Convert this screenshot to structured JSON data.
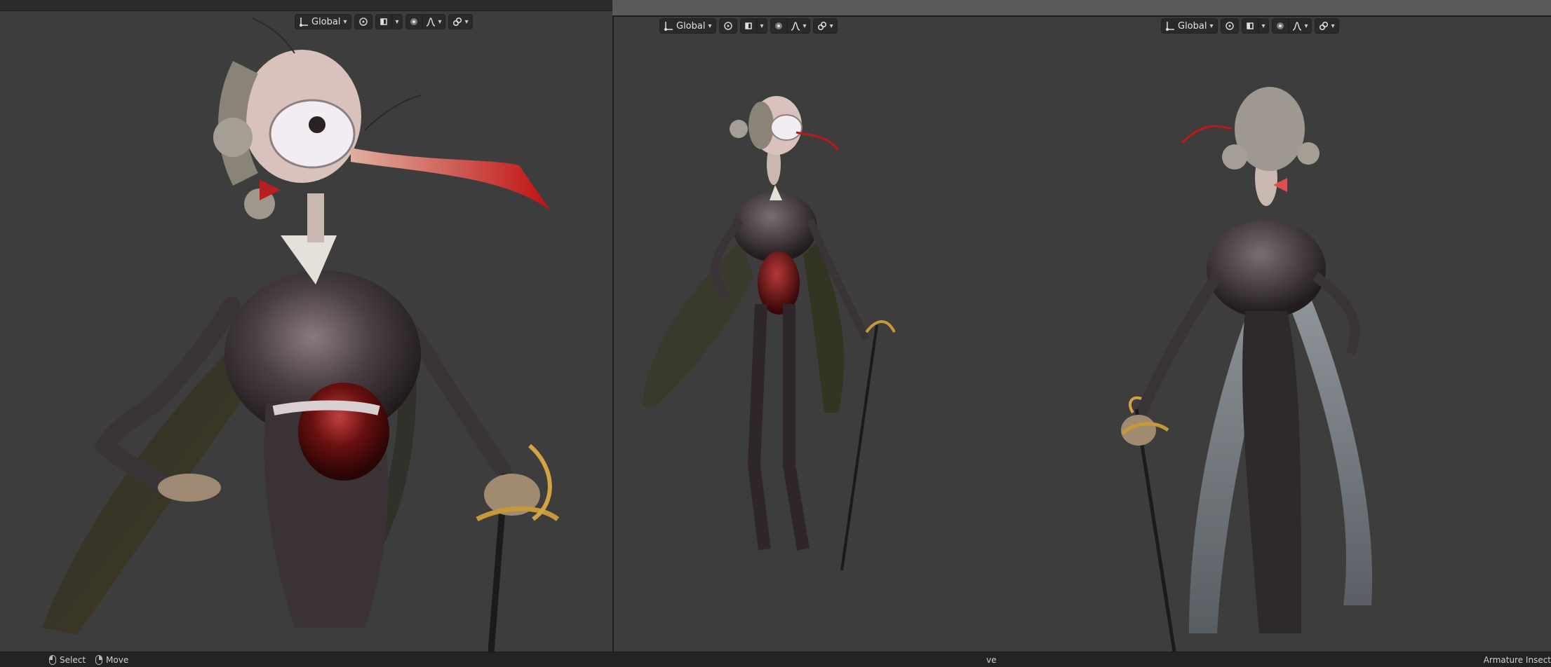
{
  "viewports": [
    {
      "header": {
        "orientation_label": "Global",
        "orientation_icon": "transform-orientation-icon",
        "pivot_icon": "pivot-point-icon",
        "snap_icon": "snap-icon",
        "proportional_icon": "proportional-editing-icon",
        "falloff_icon": "falloff-curve-icon",
        "overlay_icon": "link-icon"
      }
    },
    {
      "header": {
        "orientation_label": "Global"
      }
    },
    {
      "header": {
        "orientation_label": "Global"
      }
    }
  ],
  "statusbar": {
    "select_label": "Select",
    "move_label": "Move",
    "middle_text": "ve",
    "right_text": "Armature Insect"
  },
  "colors": {
    "viewport_bg": "#3d3d3d",
    "statusbar_bg": "#232323",
    "header_button_bg": "#2a2a2a"
  }
}
